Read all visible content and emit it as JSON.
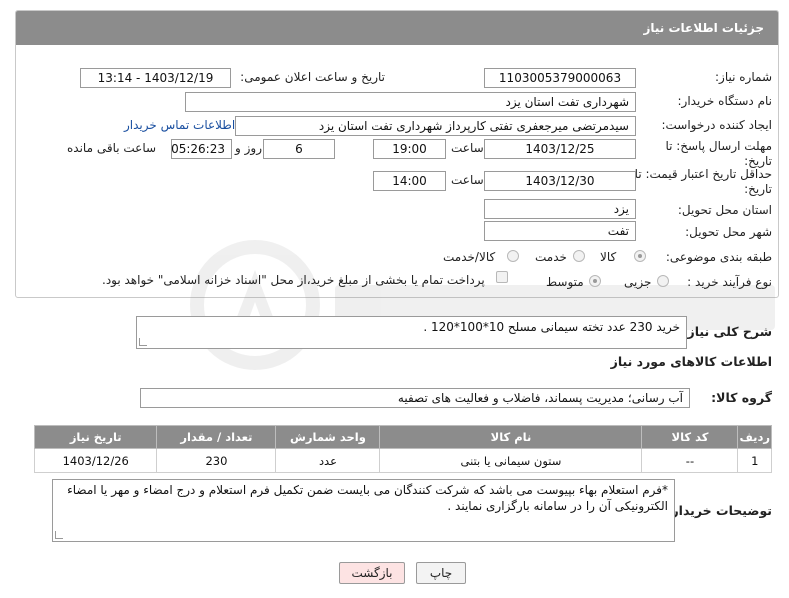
{
  "panel": {
    "title": "جزئیات اطلاعات نیاز"
  },
  "form": {
    "need_number_label": "شماره نیاز:",
    "need_number": "1103005379000063",
    "announce_label": "تاریخ و ساعت اعلان عمومی:",
    "announce_value": "1403/12/19 - 13:14",
    "buyer_org_label": "نام دستگاه خریدار:",
    "buyer_org": "شهرداری تفت استان یزد",
    "requester_label": "ایجاد کننده درخواست:",
    "requester": "سیدمرتضی میرجعفری تفتی کارپرداز شهرداری تفت استان یزد",
    "contact_link": "اطلاعات تماس خریدار",
    "deadline_label": "مهلت ارسال پاسخ: تا تاریخ:",
    "deadline_date": "1403/12/25",
    "time_label": "ساعت",
    "deadline_time": "19:00",
    "days_value": "6",
    "days_label": "روز و",
    "remaining_time": "05:26:23",
    "remaining_label": "ساعت باقی مانده",
    "validity_label": "حداقل تاریخ اعتبار قیمت: تا تاریخ:",
    "validity_date": "1403/12/30",
    "validity_time": "14:00",
    "province_label": "استان محل تحویل:",
    "province": "یزد",
    "city_label": "شهر محل تحویل:",
    "city": "تفت",
    "category_label": "طبقه بندی موضوعی:",
    "category_options": [
      "کالا",
      "خدمت",
      "کالا/خدمت"
    ],
    "process_label": "نوع فرآیند خرید :",
    "process_options": [
      "جزیی",
      "متوسط"
    ],
    "payment_note": "پرداخت تمام یا بخشی از مبلغ خرید،از محل \"اسناد خزانه اسلامی\" خواهد بود."
  },
  "summary": {
    "label": "شرح کلی نیاز:",
    "text": "خرید 230 عدد تخته سیمانی مسلح  10*100*120 ."
  },
  "goods": {
    "section_title": "اطلاعات کالاهای مورد نیاز",
    "group_label": "گروه کالا:",
    "group_value": "آب رسانی؛ مدیریت پسماند، فاضلاب و فعالیت های تصفیه",
    "columns": [
      "ردیف",
      "کد کالا",
      "نام کالا",
      "واحد شمارش",
      "تعداد / مقدار",
      "تاریخ نیاز"
    ],
    "rows": [
      [
        "1",
        "--",
        "ستون سیمانی یا بتنی",
        "عدد",
        "230",
        "1403/12/26"
      ]
    ]
  },
  "buyer_notes": {
    "label": "توضیحات خریدار:",
    "text": "*فرم استعلام بهاء بپیوست می باشد که شرکت کنندگان می بایست ضمن تکمیل فرم استعلام و درج امضاء و مهر یا امضاء الکترونیکی آن را در سامانه بارگزاری نمایند ."
  },
  "buttons": {
    "print": "چاپ",
    "back": "بازگشت"
  },
  "colors": {
    "header": "#8c8c8c",
    "link": "#1a4fa0",
    "back_button_bg": "#fde3e3"
  }
}
